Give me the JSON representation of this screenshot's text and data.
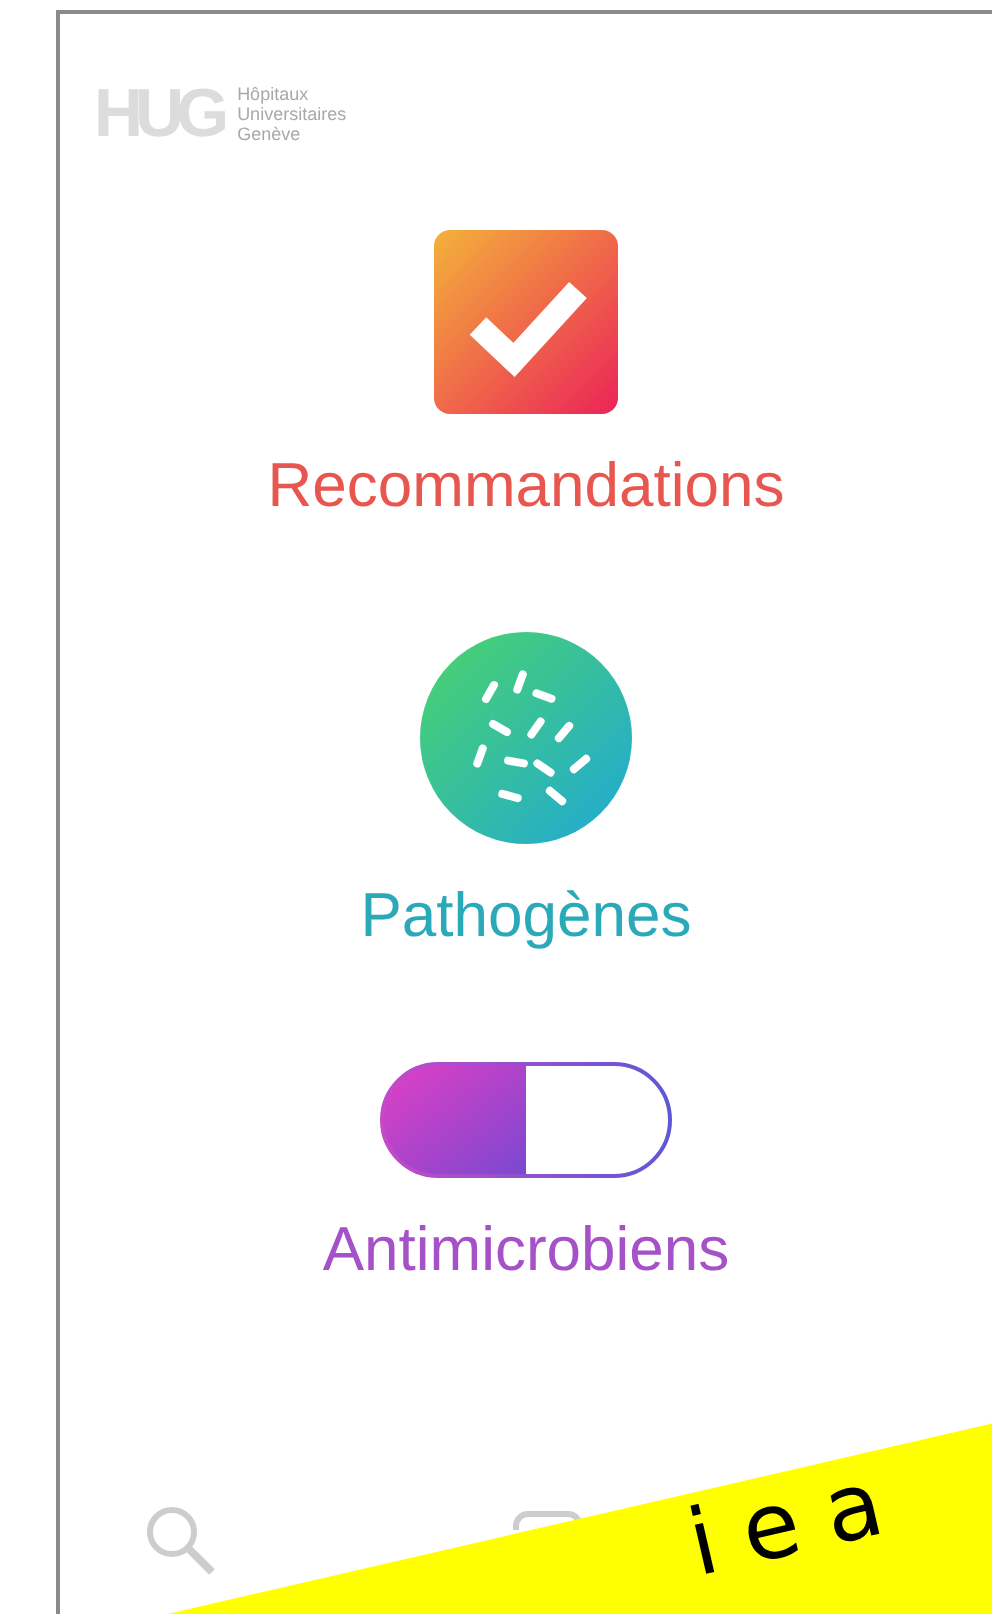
{
  "logo": {
    "mark": "HUG",
    "lines": [
      "Hôpitaux",
      "Universitaires",
      "Genève"
    ]
  },
  "menu": [
    {
      "kind": "check",
      "label": "Recommandations",
      "color": "#e8574f"
    },
    {
      "kind": "bacteria",
      "label": "Pathogènes",
      "color": "#2aaab8"
    },
    {
      "kind": "pill",
      "label": "Antimicrobiens",
      "color": "#a552c9"
    }
  ],
  "banner": {
    "text": "iea"
  }
}
